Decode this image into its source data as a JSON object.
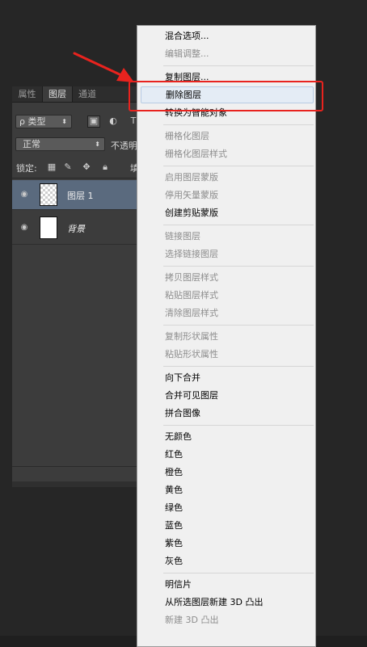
{
  "layers_panel": {
    "tabs": [
      {
        "label": "属性"
      },
      {
        "label": "图层"
      },
      {
        "label": "通道"
      }
    ],
    "filter": {
      "kind_label": "ρ 类型",
      "extra_glyph": "T"
    },
    "blend_mode": {
      "value": "正常",
      "opacity_label": "不透明"
    },
    "lock": {
      "label": "锁定:",
      "fill_label": "填"
    },
    "layers": [
      {
        "name": "图层 1",
        "selected": true,
        "thumb": "transparent"
      },
      {
        "name": "背景",
        "selected": false,
        "thumb": "white"
      }
    ]
  },
  "context_menu": {
    "groups": [
      [
        {
          "label": "混合选项...",
          "enabled": true
        },
        {
          "label": "编辑调整...",
          "enabled": false
        }
      ],
      [
        {
          "label": "复制图层...",
          "enabled": true
        },
        {
          "label": "删除图层",
          "enabled": true,
          "highlighted": true
        },
        {
          "label": "转换为智能对象",
          "enabled": true
        }
      ],
      [
        {
          "label": "栅格化图层",
          "enabled": false
        },
        {
          "label": "栅格化图层样式",
          "enabled": false
        }
      ],
      [
        {
          "label": "启用图层蒙版",
          "enabled": false
        },
        {
          "label": "停用矢量蒙版",
          "enabled": false
        },
        {
          "label": "创建剪贴蒙版",
          "enabled": true
        }
      ],
      [
        {
          "label": "链接图层",
          "enabled": false
        },
        {
          "label": "选择链接图层",
          "enabled": false
        }
      ],
      [
        {
          "label": "拷贝图层样式",
          "enabled": false
        },
        {
          "label": "粘贴图层样式",
          "enabled": false
        },
        {
          "label": "清除图层样式",
          "enabled": false
        }
      ],
      [
        {
          "label": "复制形状属性",
          "enabled": false
        },
        {
          "label": "粘贴形状属性",
          "enabled": false
        }
      ],
      [
        {
          "label": "向下合并",
          "enabled": true
        },
        {
          "label": "合并可见图层",
          "enabled": true
        },
        {
          "label": "拼合图像",
          "enabled": true
        }
      ],
      [
        {
          "label": "无颜色",
          "enabled": true
        },
        {
          "label": "红色",
          "enabled": true
        },
        {
          "label": "橙色",
          "enabled": true
        },
        {
          "label": "黄色",
          "enabled": true
        },
        {
          "label": "绿色",
          "enabled": true
        },
        {
          "label": "蓝色",
          "enabled": true
        },
        {
          "label": "紫色",
          "enabled": true
        },
        {
          "label": "灰色",
          "enabled": true
        }
      ],
      [
        {
          "label": "明信片",
          "enabled": true
        },
        {
          "label": "从所选图层新建 3D 凸出",
          "enabled": true
        },
        {
          "label": "新建 3D 凸出",
          "enabled": false
        }
      ]
    ]
  },
  "colors": {
    "annotation": "#e8231e",
    "panel_bg": "#3c3c3c",
    "selected_layer": "#5a6a7e",
    "menu_bg": "#f0f0f0"
  }
}
